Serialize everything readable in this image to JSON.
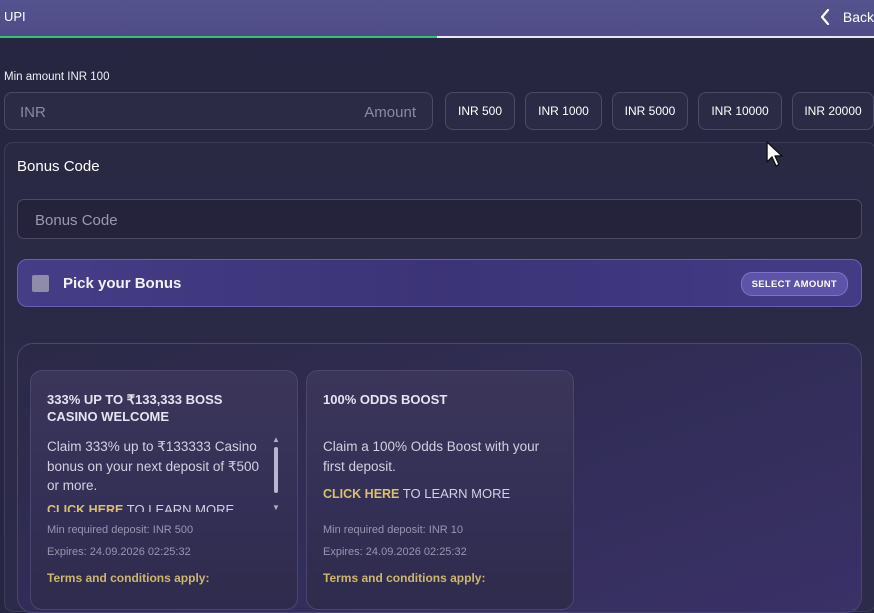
{
  "header": {
    "title": "UPI",
    "back_label": "Back",
    "progress": 0.5
  },
  "deposit": {
    "min_label": "Min amount INR 100",
    "currency": "INR",
    "amount_placeholder": "Amount",
    "presets": [
      "INR 500",
      "INR 1000",
      "INR 5000",
      "INR 10000",
      "INR 20000"
    ]
  },
  "bonus": {
    "title": "Bonus Code",
    "input_placeholder": "Bonus Code",
    "pick_label": "Pick your Bonus",
    "select_amount_label": "SELECT AMOUNT"
  },
  "offers": [
    {
      "title": "333% UP TO ₹133,333 BOSS CASINO WELCOME",
      "description": "Claim 333% up to ₹133333 Casino bonus on your next deposit of ₹500 or more.",
      "link_text": "CLICK HERE",
      "link_suffix": " TO LEARN MORE",
      "min_deposit": "Min required deposit: INR 500",
      "expires": "Expires: 24.09.2026 02:25:32",
      "terms": "Terms and conditions apply:"
    },
    {
      "title": "100% ODDS BOOST",
      "description": "Claim a 100% Odds Boost with your first deposit.",
      "link_text": "CLICK HERE",
      "link_suffix": " TO LEARN MORE",
      "min_deposit": "Min required deposit: INR 10",
      "expires": "Expires: 24.09.2026 02:25:32",
      "terms": "Terms and conditions apply:"
    }
  ],
  "colors": {
    "accent": "#5d54a8",
    "progress": "#35c07a",
    "link": "#d9c06a"
  }
}
